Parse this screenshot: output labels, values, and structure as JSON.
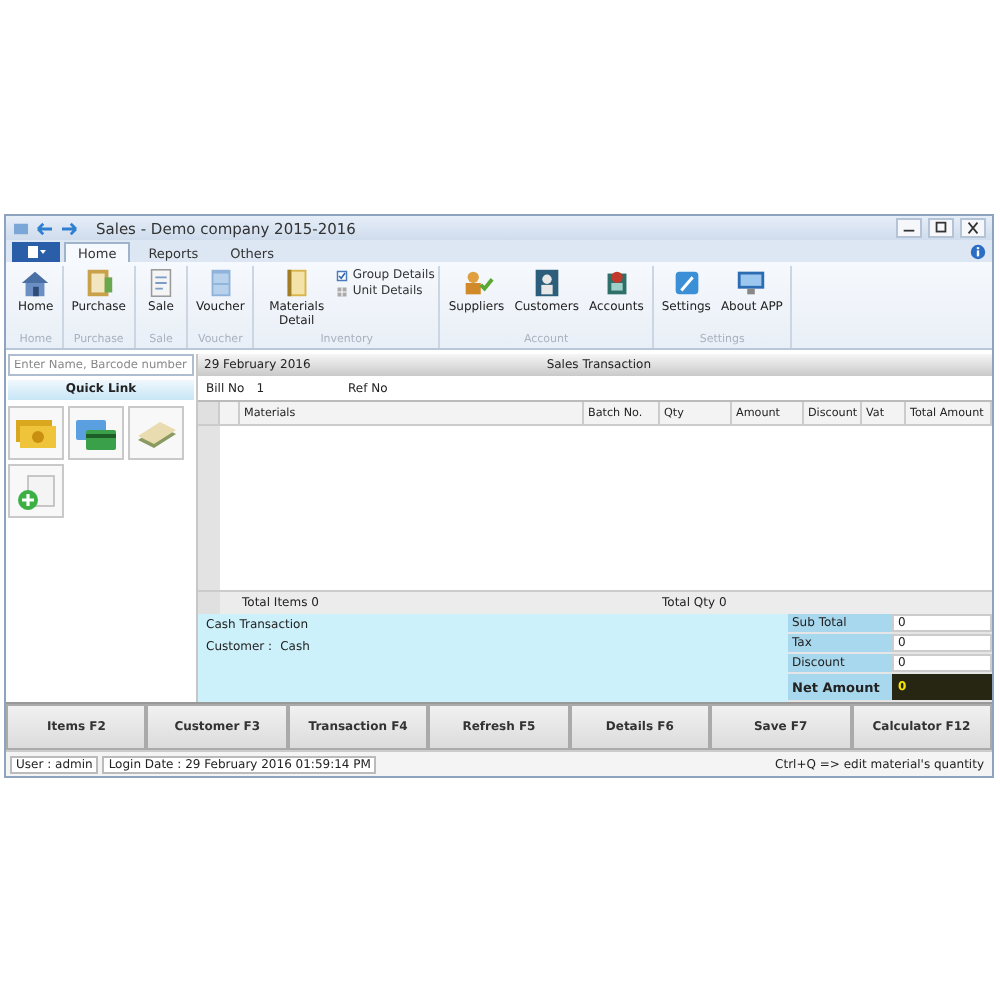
{
  "window": {
    "title": "Sales - Demo company 2015-2016"
  },
  "tabs": [
    {
      "label": "Home",
      "selected": true
    },
    {
      "label": "Reports",
      "selected": false
    },
    {
      "label": "Others",
      "selected": false
    }
  ],
  "ribbon_groups": [
    {
      "label": "Home",
      "items": [
        {
          "label": "Home",
          "kind": "large"
        }
      ]
    },
    {
      "label": "Purchase",
      "items": [
        {
          "label": "Purchase",
          "kind": "large"
        }
      ]
    },
    {
      "label": "Sale",
      "items": [
        {
          "label": "Sale",
          "kind": "large"
        }
      ]
    },
    {
      "label": "Voucher",
      "items": [
        {
          "label": "Voucher",
          "kind": "large"
        }
      ]
    },
    {
      "label": "Inventory",
      "items": [
        {
          "label": "Materials Detail",
          "kind": "large"
        },
        {
          "label": "Group Details",
          "kind": "small"
        },
        {
          "label": "Unit Details",
          "kind": "small"
        }
      ]
    },
    {
      "label": "Account",
      "items": [
        {
          "label": "Suppliers",
          "kind": "large"
        },
        {
          "label": "Customers",
          "kind": "large"
        },
        {
          "label": "Accounts",
          "kind": "large"
        }
      ]
    },
    {
      "label": "Settings",
      "items": [
        {
          "label": "Settings",
          "kind": "large"
        },
        {
          "label": "About APP",
          "kind": "large"
        }
      ]
    }
  ],
  "search": {
    "placeholder": "Enter Name, Barcode number"
  },
  "quick_link": {
    "title": "Quick Link"
  },
  "transaction": {
    "date": "29 February 2016",
    "title": "Sales Transaction",
    "bill_no_label": "Bill No",
    "bill_no": "1",
    "ref_no_label": "Ref No"
  },
  "table": {
    "columns": [
      "Materials",
      "Batch No.",
      "Qty",
      "Amount",
      "Discount",
      "Vat",
      "Total Amount"
    ],
    "total_items": "Total Items 0",
    "total_qty": "Total Qty 0"
  },
  "payment": {
    "type": "Cash Transaction",
    "customer_label": "Customer :",
    "customer": "Cash"
  },
  "totals": [
    {
      "label": "Sub Total",
      "value": "0",
      "kind": "normal"
    },
    {
      "label": "Tax",
      "value": "0",
      "kind": "normal"
    },
    {
      "label": "Discount",
      "value": "0",
      "kind": "normal"
    },
    {
      "label": "Net Amount",
      "value": "0",
      "kind": "net"
    }
  ],
  "buttons": [
    "Items F2",
    "Customer F3",
    "Transaction F4",
    "Refresh F5",
    "Details F6",
    "Save F7",
    "Calculator F12"
  ],
  "status_bar": {
    "user": "User : admin",
    "login": "Login Date : 29 February 2016 01:59:14 PM",
    "hint": "Ctrl+Q => edit material's quantity"
  }
}
